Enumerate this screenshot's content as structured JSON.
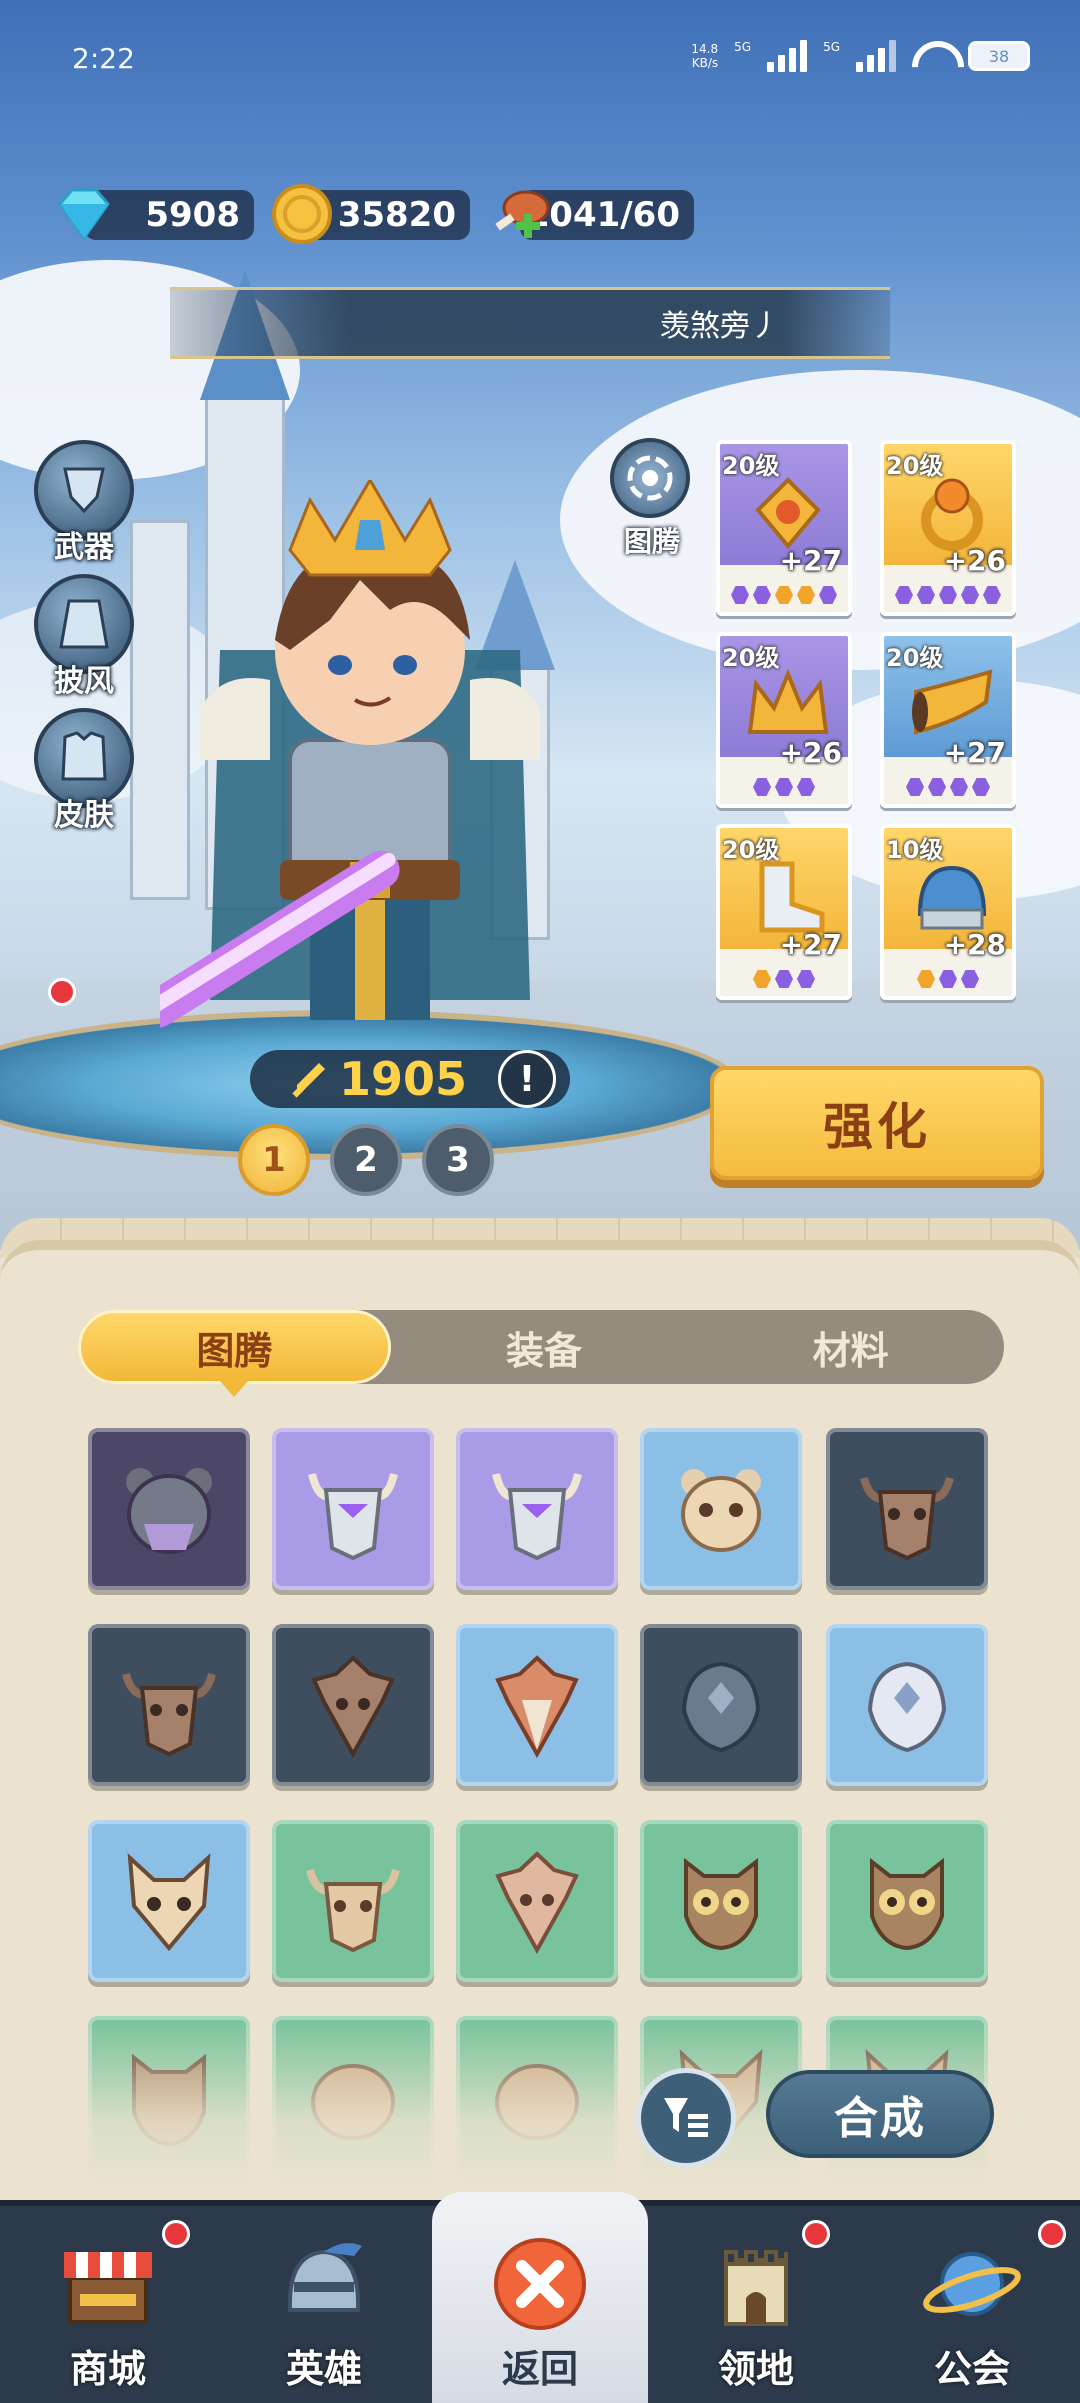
{
  "status_bar": {
    "time": "2:22",
    "net_speed": "14.8",
    "net_unit": "KB/s",
    "net_type_1": "5G",
    "net_type_2": "5G",
    "battery": "38"
  },
  "resources": {
    "gems": "5908",
    "gold": "35820",
    "stamina": "1041/60"
  },
  "player_name": "羡煞旁丿",
  "side_menu": [
    {
      "label": "武器",
      "icon": "sword-icon"
    },
    {
      "label": "披风",
      "icon": "cape-icon"
    },
    {
      "label": "皮肤",
      "icon": "armor-icon"
    }
  ],
  "totem_button_label": "图腾",
  "equipment": [
    {
      "level": "20级",
      "bonus": "+27",
      "rarity": "purple",
      "gems": [
        "p",
        "p",
        "o",
        "o",
        "p"
      ],
      "icon": "amulet-icon"
    },
    {
      "level": "20级",
      "bonus": "+26",
      "rarity": "gold",
      "gems": [
        "p",
        "p",
        "p",
        "p",
        "p"
      ],
      "icon": "ring-icon"
    },
    {
      "level": "20级",
      "bonus": "+26",
      "rarity": "purple",
      "gems": [
        "p",
        "p",
        "p"
      ],
      "icon": "crown-icon"
    },
    {
      "level": "20级",
      "bonus": "+27",
      "rarity": "blue",
      "gems": [
        "p",
        "p",
        "p",
        "p"
      ],
      "icon": "horn-icon"
    },
    {
      "level": "20级",
      "bonus": "+27",
      "rarity": "gold",
      "gems": [
        "o",
        "p",
        "p"
      ],
      "icon": "boots-icon"
    },
    {
      "level": "10级",
      "bonus": "+28",
      "rarity": "gold",
      "gems": [
        "o",
        "p",
        "p"
      ],
      "icon": "helmet-icon"
    }
  ],
  "power": "1905",
  "pages": [
    "1",
    "2",
    "3"
  ],
  "active_page": "1",
  "strengthen_label": "强化",
  "tabs": [
    {
      "label": "图腾",
      "active": true
    },
    {
      "label": "装备",
      "active": false
    },
    {
      "label": "材料",
      "active": false
    }
  ],
  "totems": [
    {
      "color": "dpurple",
      "icon": "bear-mask-icon"
    },
    {
      "color": "purple",
      "icon": "bull-mask-icon"
    },
    {
      "color": "purple",
      "icon": "bull-mask-icon"
    },
    {
      "color": "blue",
      "icon": "bear-skull-icon"
    },
    {
      "color": "dark",
      "icon": "bull-skull-icon"
    },
    {
      "color": "dark",
      "icon": "bull-skull-icon"
    },
    {
      "color": "dark",
      "icon": "bird-skull-icon"
    },
    {
      "color": "blue",
      "icon": "bird-skull-icon"
    },
    {
      "color": "dark",
      "icon": "fish-skull-icon"
    },
    {
      "color": "blue",
      "icon": "fish-skull-icon"
    },
    {
      "color": "blue",
      "icon": "cat-skull-icon"
    },
    {
      "color": "green",
      "icon": "bull-skull-icon"
    },
    {
      "color": "green",
      "icon": "bird-skull-icon"
    },
    {
      "color": "green",
      "icon": "owl-mask-icon"
    },
    {
      "color": "green",
      "icon": "owl-mask-icon"
    },
    {
      "color": "green",
      "icon": "owl-mask-icon"
    },
    {
      "color": "green",
      "icon": "turtle-mask-icon"
    },
    {
      "color": "green",
      "icon": "turtle-mask-icon"
    },
    {
      "color": "green",
      "icon": "cat-mask-icon"
    },
    {
      "color": "green",
      "icon": "cat-mask-icon"
    }
  ],
  "combine_label": "合成",
  "nav": [
    {
      "label": "商城",
      "icon": "shop-icon",
      "badge": true
    },
    {
      "label": "英雄",
      "icon": "hero-helmet-icon",
      "badge": false
    },
    {
      "label": "返回",
      "icon": "close-icon",
      "badge": false,
      "center": true
    },
    {
      "label": "领地",
      "icon": "castle-icon",
      "badge": true
    },
    {
      "label": "公会",
      "icon": "planet-icon",
      "badge": true
    }
  ],
  "colors": {
    "gold_button": "#f4bb3d",
    "dark_button": "#3d5f78",
    "badge_red": "#e7373d",
    "panel_bg": "#ebe3cf"
  }
}
